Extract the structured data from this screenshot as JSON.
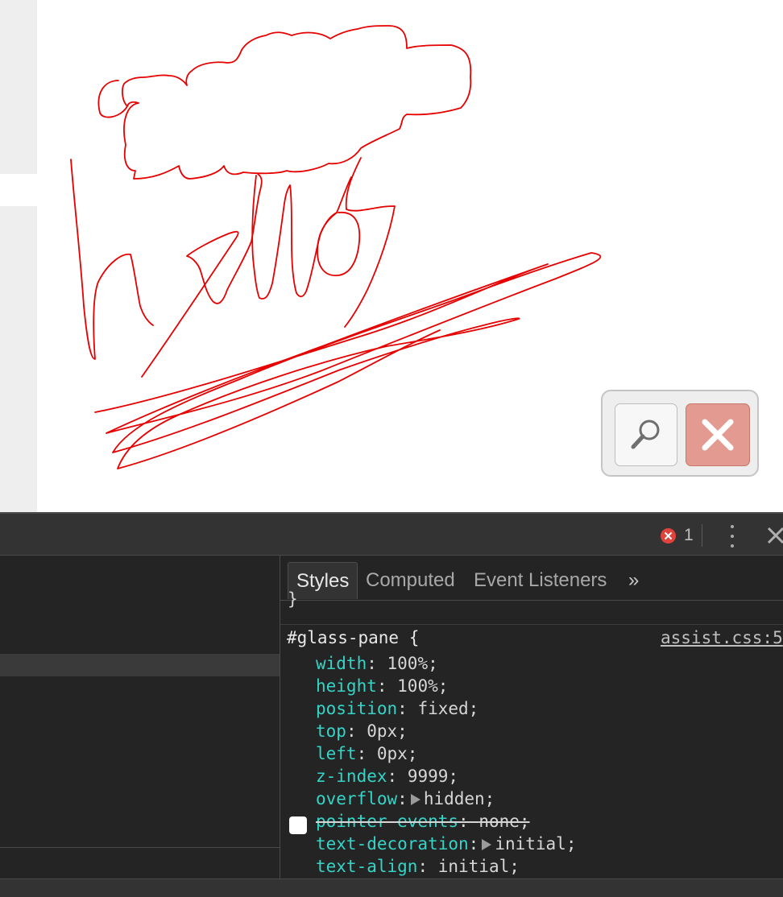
{
  "devtools": {
    "error_count": "1",
    "tabs": [
      {
        "label": "Styles"
      },
      {
        "label": "Computed"
      },
      {
        "label": "Event Listeners"
      }
    ],
    "more_tabs_glyph": "»",
    "styles": {
      "previous_rule_brace": "}",
      "selector": "#glass-pane {",
      "source": "assist.css:5",
      "properties": [
        {
          "name": "width",
          "value": "100%;"
        },
        {
          "name": "height",
          "value": "100%;"
        },
        {
          "name": "position",
          "value": "fixed;"
        },
        {
          "name": "top",
          "value": "0px;"
        },
        {
          "name": "left",
          "value": "0px;"
        },
        {
          "name": "z-index",
          "value": "9999;"
        },
        {
          "name": "overflow",
          "value": "hidden;",
          "expandable": true
        },
        {
          "name": "pointer-events",
          "value": "none;",
          "disabled": true
        },
        {
          "name": "text-decoration",
          "value": "initial;",
          "expandable": true
        },
        {
          "name": "text-align",
          "value": "initial;"
        }
      ]
    }
  },
  "icons": {
    "zoom": "magnifier-icon",
    "close": "close-x-icon",
    "error": "error-circle-icon",
    "menu": "kebab-menu-icon"
  },
  "colors": {
    "ink": "#e60000",
    "close_button": "#e39a90",
    "css_property": "#35d4c7",
    "error_badge": "#e0433c"
  }
}
